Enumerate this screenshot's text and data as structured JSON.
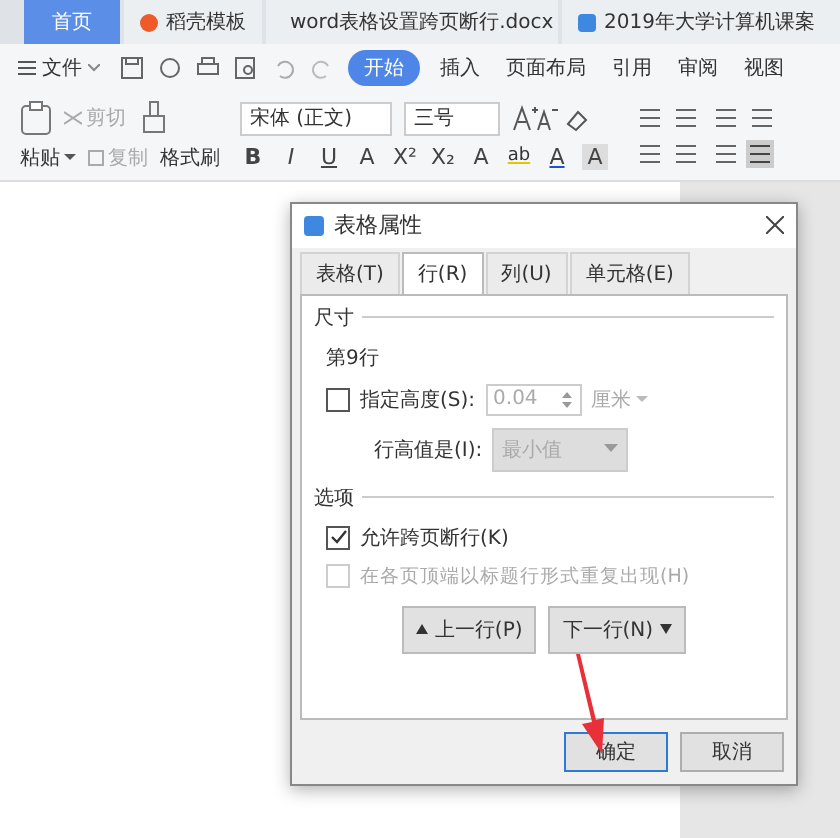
{
  "tabs": [
    {
      "label": "首页",
      "kind": "home",
      "selected": true
    },
    {
      "label": "稻壳模板",
      "kind": "template",
      "selected": false
    },
    {
      "label": "word表格设置跨页断行.docx",
      "kind": "doc",
      "selected": false
    },
    {
      "label": "2019年大学计算机课案",
      "kind": "doc",
      "selected": false
    }
  ],
  "menu": {
    "file": "文件",
    "items": [
      {
        "label": "开始",
        "selected": true
      },
      {
        "label": "插入",
        "selected": false
      },
      {
        "label": "页面布局",
        "selected": false
      },
      {
        "label": "引用",
        "selected": false
      },
      {
        "label": "审阅",
        "selected": false
      },
      {
        "label": "视图",
        "selected": false
      }
    ]
  },
  "ribbon": {
    "paste": "粘贴",
    "cut": "剪切",
    "copy": "复制",
    "format_painter": "格式刷",
    "font": "宋体 (正文)",
    "size": "三号",
    "format_glyphs": [
      "B",
      "I",
      "U",
      "A",
      "X²",
      "X₂",
      "A",
      "ab",
      "A",
      "A"
    ]
  },
  "dialog": {
    "title": "表格属性",
    "tabs": [
      {
        "label": "表格(T)",
        "selected": false
      },
      {
        "label": "行(R)",
        "selected": true
      },
      {
        "label": "列(U)",
        "selected": false
      },
      {
        "label": "单元格(E)",
        "selected": false
      }
    ],
    "size_group": "尺寸",
    "row_label": "第9行",
    "height": {
      "label": "指定高度(S):",
      "checked": false,
      "value": "0.04",
      "unit": "厘米"
    },
    "rule": {
      "label": "行高值是(I):",
      "value": "最小值",
      "disabled": true
    },
    "options_group": "选项",
    "options": [
      {
        "label": "允许跨页断行(K)",
        "checked": true,
        "disabled": false
      },
      {
        "label": "在各页顶端以标题行形式重复出现(H)",
        "checked": false,
        "disabled": true
      }
    ],
    "prev": "上一行(P)",
    "next": "下一行(N)",
    "buttons": [
      {
        "label": "确定",
        "selected": true
      },
      {
        "label": "取消",
        "selected": false
      }
    ]
  }
}
